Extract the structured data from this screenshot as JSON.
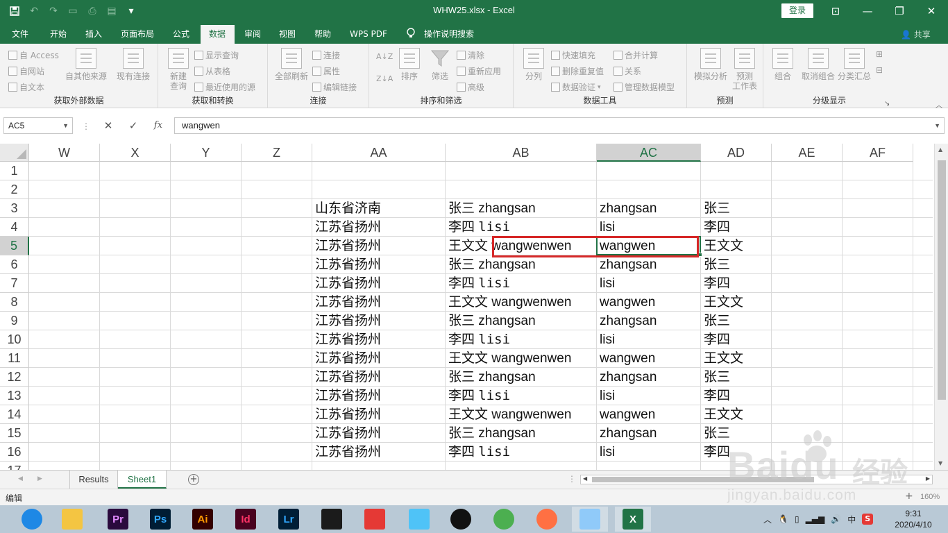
{
  "titlebar": {
    "title": "WHW25.xlsx  -  Excel",
    "login_label": "登录",
    "accent": "#217346"
  },
  "menu": {
    "tabs": [
      "文件",
      "开始",
      "插入",
      "页面布局",
      "公式",
      "数据",
      "审阅",
      "视图",
      "帮助",
      "WPS PDF"
    ],
    "active_tab": "数据",
    "tell_me": "操作说明搜索",
    "share": "共享"
  },
  "ribbon": {
    "get_external": {
      "label": "获取外部数据",
      "from_access": "自 Access",
      "from_web": "自网站",
      "from_text": "自文本",
      "from_other": "自其他来源",
      "existing": "现有连接"
    },
    "get_transform": {
      "label": "获取和转换",
      "new_query_1": "新建",
      "new_query_2": "查询",
      "show_query": "显示查询",
      "from_table": "从表格",
      "recent_sources": "最近使用的源"
    },
    "connections": {
      "label": "连接",
      "refresh_all": "全部刷新",
      "connections": "连接",
      "properties": "属性",
      "edit_links": "编辑链接"
    },
    "sort_filter": {
      "label": "排序和筛选",
      "sort": "排序",
      "filter": "筛选",
      "clear": "清除",
      "reapply": "重新应用",
      "advanced": "高级"
    },
    "data_tools": {
      "label": "数据工具",
      "split": "分列",
      "flash_fill": "快速填充",
      "remove_dup": "删除重复值",
      "validation": "数据验证",
      "consolidate": "合并计算",
      "relationships": "关系",
      "manage_model": "管理数据模型"
    },
    "forecast": {
      "label": "预测",
      "whatif": "模拟分析",
      "sheet_1": "预测",
      "sheet_2": "工作表"
    },
    "outline": {
      "label": "分级显示",
      "group": "组合",
      "ungroup": "取消组合",
      "subtotal": "分类汇总"
    }
  },
  "formula_bar": {
    "name_box": "AC5",
    "fx": "fx",
    "value": "wangwen"
  },
  "grid": {
    "columns": [
      "W",
      "X",
      "Y",
      "Z",
      "AA",
      "AB",
      "AC",
      "AD",
      "AE",
      "AF"
    ],
    "selected_column": "AC",
    "rows": [
      "1",
      "2",
      "3",
      "4",
      "5",
      "6",
      "7",
      "8",
      "9",
      "10",
      "11",
      "12",
      "13",
      "14",
      "15",
      "16",
      "17"
    ],
    "selected_row": "5",
    "data": [
      {
        "aa": "",
        "ab_cn": "",
        "ab_en": "",
        "ac": "",
        "ad": ""
      },
      {
        "aa": "",
        "ab_cn": "",
        "ab_en": "",
        "ac": "",
        "ad": ""
      },
      {
        "aa": "山东省济南",
        "ab_cn": "张三",
        "ab_en": "zhangsan",
        "ac": "zhangsan",
        "ad": "张三"
      },
      {
        "aa": "江苏省扬州",
        "ab_cn": "李四",
        "ab_en": "lisi",
        "ac": "lisi",
        "ad": "李四"
      },
      {
        "aa": "江苏省扬州",
        "ab_cn": "王文文",
        "ab_en": "wangwenwen",
        "ac": "wangwen",
        "ad": "王文文"
      },
      {
        "aa": "江苏省扬州",
        "ab_cn": "张三",
        "ab_en": "zhangsan",
        "ac": "zhangsan",
        "ad": "张三"
      },
      {
        "aa": "江苏省扬州",
        "ab_cn": "李四",
        "ab_en": "lisi",
        "ac": "lisi",
        "ad": "李四"
      },
      {
        "aa": "江苏省扬州",
        "ab_cn": "王文文",
        "ab_en": "wangwenwen",
        "ac": "wangwen",
        "ad": "王文文"
      },
      {
        "aa": "江苏省扬州",
        "ab_cn": "张三",
        "ab_en": "zhangsan",
        "ac": "zhangsan",
        "ad": "张三"
      },
      {
        "aa": "江苏省扬州",
        "ab_cn": "李四",
        "ab_en": "lisi",
        "ac": "lisi",
        "ad": "李四"
      },
      {
        "aa": "江苏省扬州",
        "ab_cn": "王文文",
        "ab_en": "wangwenwen",
        "ac": "wangwen",
        "ad": "王文文"
      },
      {
        "aa": "江苏省扬州",
        "ab_cn": "张三",
        "ab_en": "zhangsan",
        "ac": "zhangsan",
        "ad": "张三"
      },
      {
        "aa": "江苏省扬州",
        "ab_cn": "李四",
        "ab_en": "lisi",
        "ac": "lisi",
        "ad": "李四"
      },
      {
        "aa": "江苏省扬州",
        "ab_cn": "王文文",
        "ab_en": "wangwenwen",
        "ac": "wangwen",
        "ad": "王文文"
      },
      {
        "aa": "江苏省扬州",
        "ab_cn": "张三",
        "ab_en": "zhangsan",
        "ac": "zhangsan",
        "ad": "张三"
      },
      {
        "aa": "江苏省扬州",
        "ab_cn": "李四",
        "ab_en": "lisi",
        "ac": "lisi",
        "ad": "李四"
      }
    ],
    "highlight_color": "#d62828"
  },
  "sheets": {
    "tabs": [
      "Results",
      "Sheet1"
    ],
    "active": "Sheet1"
  },
  "status": {
    "mode": "编辑",
    "zoom": "160%"
  },
  "watermark": {
    "logo": "Baidu",
    "cn": "经验",
    "url": "jingyan.baidu.com"
  },
  "taskbar": {
    "apps": [
      {
        "name": "browser-icon",
        "label": "",
        "bg": "#1e88e5",
        "fg": "#fff"
      },
      {
        "name": "file-explorer-icon",
        "label": "",
        "bg": "#f4c542",
        "fg": "#fff"
      },
      {
        "name": "premiere-icon",
        "label": "Pr",
        "bg": "#2a0a3d",
        "fg": "#e38bff"
      },
      {
        "name": "photoshop-icon",
        "label": "Ps",
        "bg": "#001d34",
        "fg": "#31a8ff"
      },
      {
        "name": "illustrator-icon",
        "label": "Ai",
        "bg": "#330000",
        "fg": "#ff9a00"
      },
      {
        "name": "indesign-icon",
        "label": "Id",
        "bg": "#49021f",
        "fg": "#ff3366"
      },
      {
        "name": "lightroom-icon",
        "label": "Lr",
        "bg": "#001e36",
        "fg": "#31a8ff"
      },
      {
        "name": "video-editor-icon",
        "label": "",
        "bg": "#1b1b1b",
        "fg": "#fff"
      },
      {
        "name": "sogou-icon",
        "label": "",
        "bg": "#e53935",
        "fg": "#fff"
      },
      {
        "name": "app-icon",
        "label": "",
        "bg": "#4fc3f7",
        "fg": "#fff"
      },
      {
        "name": "qq-icon",
        "label": "",
        "bg": "#111111",
        "fg": "#fff"
      },
      {
        "name": "chrome-icon",
        "label": "",
        "bg": "#4caf50",
        "fg": "#fff"
      },
      {
        "name": "player-icon",
        "label": "",
        "bg": "#ff7043",
        "fg": "#fff"
      },
      {
        "name": "notes-icon",
        "label": "",
        "bg": "#90caf9",
        "fg": "#fff"
      },
      {
        "name": "excel-icon",
        "label": "X",
        "bg": "#217346",
        "fg": "#fff"
      }
    ],
    "ime": "中",
    "time": "9:31",
    "date": "2020/4/10"
  }
}
